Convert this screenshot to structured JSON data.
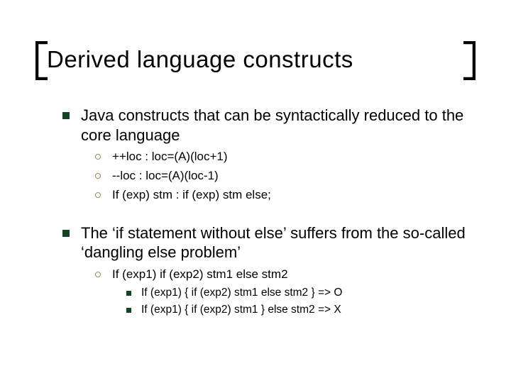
{
  "title": "Derived language constructs",
  "points": [
    {
      "text": "Java constructs that can be syntactically reduced to the core language",
      "subs": [
        {
          "text": "++loc : loc=(A)(loc+1)"
        },
        {
          "text": "--loc : loc=(A)(loc-1)"
        },
        {
          "text": "If (exp) stm : if (exp) stm else;"
        }
      ]
    },
    {
      "text": "The ‘if statement without else’ suffers from the so-called ‘dangling else problem’",
      "subs": [
        {
          "text": "If (exp1) if (exp2) stm1 else stm2",
          "subsubs": [
            {
              "text": "If (exp1) { if (exp2) stm1   else stm2 } => O"
            },
            {
              "text": "If (exp1) { if (exp2) stm1 } else stm2   => X"
            }
          ]
        }
      ]
    }
  ]
}
